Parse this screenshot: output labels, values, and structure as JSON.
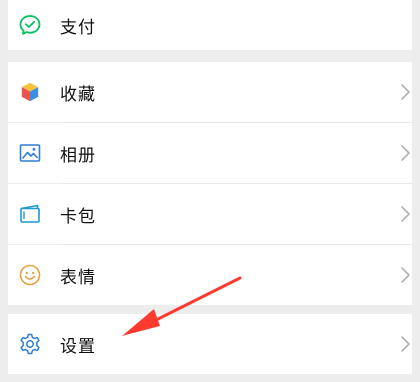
{
  "menu": {
    "items": [
      {
        "label": "支付",
        "icon": "pay-icon"
      },
      {
        "label": "收藏",
        "icon": "favorites-icon"
      },
      {
        "label": "相册",
        "icon": "album-icon"
      },
      {
        "label": "卡包",
        "icon": "card-wallet-icon"
      },
      {
        "label": "表情",
        "icon": "stickers-icon"
      },
      {
        "label": "设置",
        "icon": "settings-icon"
      }
    ]
  },
  "colors": {
    "background": "#ededed",
    "row": "#ffffff",
    "text": "#111111",
    "chevron": "#b2b2b2",
    "pay_green": "#07c160",
    "album_blue": "#2d7fd3",
    "card_blue": "#1f9ac9",
    "sticker_yellow": "#e6a23c",
    "settings_blue": "#2d7fd3",
    "annotation_arrow": "#ff3b30"
  }
}
